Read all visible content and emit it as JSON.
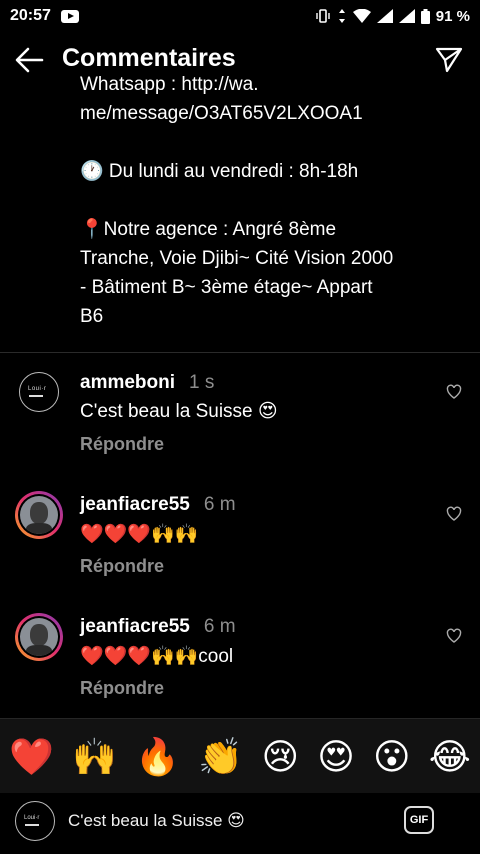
{
  "status_bar": {
    "time": "20:57",
    "battery": "91 %"
  },
  "header": {
    "title": "Commentaires"
  },
  "caption_text": "Whatsapp : http://wa.\nme/message/O3AT65V2LXOOA1\n\n🕐 Du lundi au vendredi : 8h-18h\n\n📍Notre agence : Angré 8ème\nTranche, Voie Djibi~ Cité Vision 2000\n- Bâtiment B~ 3ème étage~ Appart\nB6",
  "comments": [
    {
      "username": "ammeboni",
      "time": "1 s",
      "text": "C'est beau la Suisse 😍",
      "reply": "Répondre"
    },
    {
      "username": "jeanfiacre55",
      "time": "6 m",
      "text": "❤️❤️❤️🙌🙌",
      "reply": "Répondre"
    },
    {
      "username": "jeanfiacre55",
      "time": "6 m",
      "text": "❤️❤️❤️🙌🙌cool",
      "reply": "Répondre"
    }
  ],
  "emoji_bar": [
    "❤️",
    "🙌",
    "🔥",
    "👏",
    "😢",
    "😍",
    "😮",
    "😂"
  ],
  "input": {
    "text": "C'est beau la Suisse 😍",
    "gif_label": "GIF"
  },
  "avatar_logo_text": "Loui·r"
}
